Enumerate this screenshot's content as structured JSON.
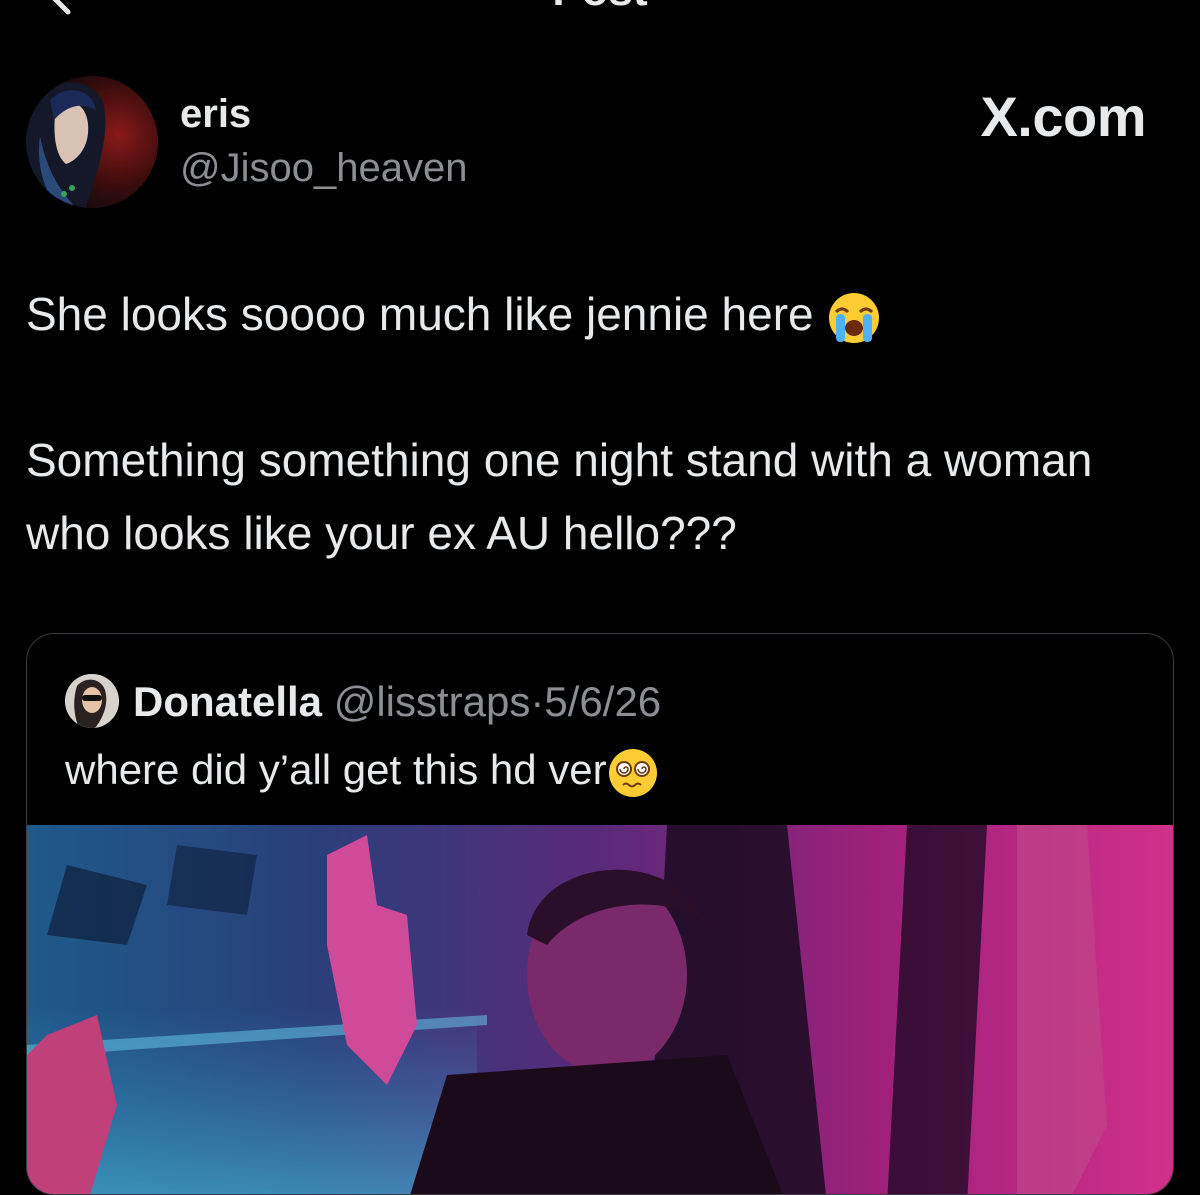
{
  "nav": {
    "title": "Post"
  },
  "author": {
    "name": "eris",
    "handle": "@Jisoo_heaven"
  },
  "brand": "X.com",
  "post": {
    "paragraph1": "She looks soooo much like jennie here",
    "paragraph1_emoji": "loudly-crying-face-emoji",
    "paragraph2": "Something something one night stand with a woman who looks like your ex AU hello???"
  },
  "quote": {
    "name": "Donatella",
    "handle": "@lisstraps",
    "separator": "·",
    "date": "5/6/26",
    "text": "where did y’all get this hd ver",
    "text_emoji": "dizzy-face-emoji"
  },
  "colors": {
    "background": "#000000",
    "text_primary": "#e7e9ea",
    "text_secondary": "#8b8f94",
    "card_border": "#3a3d41"
  }
}
